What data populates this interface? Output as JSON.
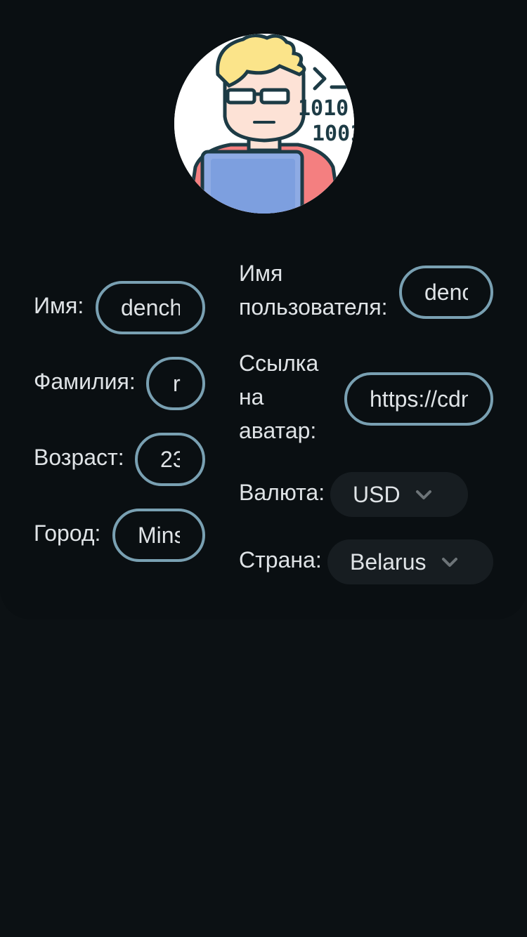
{
  "profile": {
    "avatar_alt": "",
    "first_name": {
      "label": "Имя:",
      "value": "dench"
    },
    "last_name": {
      "label": "Фамилия:",
      "value": "r"
    },
    "age": {
      "label": "Возраст:",
      "value": "23"
    },
    "city": {
      "label": "Город:",
      "value": "Minsk"
    },
    "username": {
      "label_line1": "Имя",
      "label_line2": "пользователя:",
      "value": "dench"
    },
    "avatar_link": {
      "label_line1": "Ссылка",
      "label_line2": "на",
      "label_line3": "аватар:",
      "value": "https://cdn"
    },
    "currency": {
      "label": "Валюта:",
      "value": "USD"
    },
    "country": {
      "label": "Страна:",
      "value": "Belarus"
    }
  },
  "colors": {
    "background": "#0c1114",
    "card": "#0a0f12",
    "field_border": "#79a0b2",
    "select_bg": "#171d21",
    "text": "#dfe3e6"
  }
}
